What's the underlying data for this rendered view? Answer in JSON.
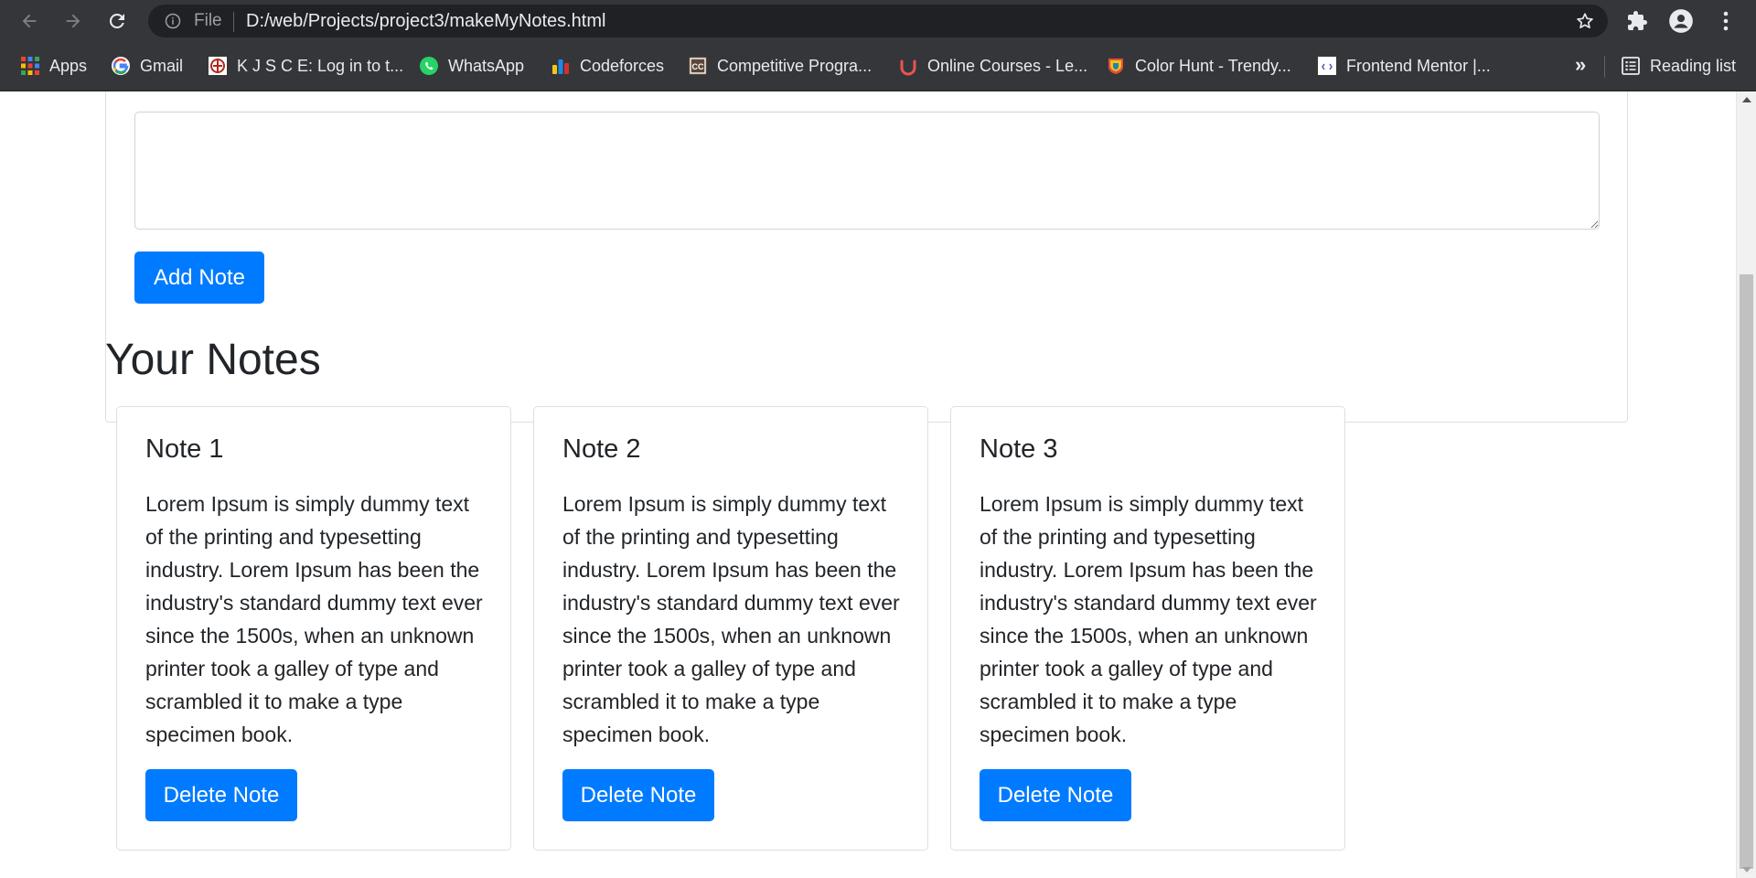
{
  "browser": {
    "omnibox": {
      "scheme_label": "File",
      "url": "D:/web/Projects/project3/makeMyNotes.html"
    },
    "bookmarks": [
      {
        "label": "Apps",
        "icon": "apps-grid-icon"
      },
      {
        "label": "Gmail",
        "icon": "google-icon"
      },
      {
        "label": "K J S C E: Log in to t...",
        "icon": "kjsce-icon"
      },
      {
        "label": "WhatsApp",
        "icon": "whatsapp-icon"
      },
      {
        "label": "Codeforces",
        "icon": "codeforces-icon"
      },
      {
        "label": "Competitive Progra...",
        "icon": "codechef-icon"
      },
      {
        "label": "Online Courses - Le...",
        "icon": "udemy-icon"
      },
      {
        "label": "Color Hunt - Trendy...",
        "icon": "colorhunt-icon"
      },
      {
        "label": "Frontend Mentor |...",
        "icon": "frontend-mentor-icon"
      }
    ],
    "more_label": "»",
    "reading_list_label": "Reading list"
  },
  "form": {
    "textarea_value": "",
    "add_button_label": "Add Note"
  },
  "notes_section": {
    "title": "Your Notes"
  },
  "notes": [
    {
      "title": "Note 1",
      "text": "Lorem Ipsum is simply dummy text of the printing and typesetting industry. Lorem Ipsum has been the industry's standard dummy text ever since the 1500s, when an unknown printer took a galley of type and scrambled it to make a type specimen book.",
      "delete_label": "Delete Note"
    },
    {
      "title": "Note 2",
      "text": "Lorem Ipsum is simply dummy text of the printing and typesetting industry. Lorem Ipsum has been the industry's standard dummy text ever since the 1500s, when an unknown printer took a galley of type and scrambled it to make a type specimen book.",
      "delete_label": "Delete Note"
    },
    {
      "title": "Note 3",
      "text": "Lorem Ipsum is simply dummy text of the printing and typesetting industry. Lorem Ipsum has been the industry's standard dummy text ever since the 1500s, when an unknown printer took a galley of type and scrambled it to make a type specimen book.",
      "delete_label": "Delete Note"
    }
  ],
  "colors": {
    "primary": "#007bff",
    "chrome_bg": "#35363a",
    "omnibox_bg": "#202124",
    "text_dark": "#212529"
  }
}
